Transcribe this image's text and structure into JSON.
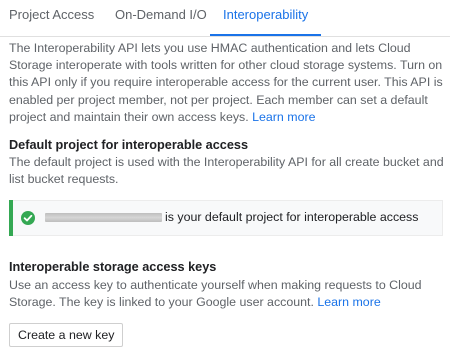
{
  "tabs": [
    {
      "label": "Project Access",
      "active": false
    },
    {
      "label": "On-Demand I/O",
      "active": false
    },
    {
      "label": "Interoperability",
      "active": true
    }
  ],
  "intro": {
    "text": "The Interoperability API lets you use HMAC authentication and lets Cloud Storage interoperate with tools written for other cloud storage systems. Turn on this API only if you require interoperable access for the current user. This API is enabled per project member, not per project. Each member can set a default project and maintain their own access keys. ",
    "link": "Learn more"
  },
  "default_project": {
    "heading": "Default project for interoperable access",
    "description": "The default project is used with the Interoperability API for all create bucket and list bucket requests.",
    "notice_text": "is your default project for interoperable access",
    "status_icon": "check-circle-icon",
    "status_color": "#34a853"
  },
  "access_keys": {
    "heading": "Interoperable storage access keys",
    "description": "Use an access key to authenticate yourself when making requests to Cloud Storage. The key is linked to your Google user account. ",
    "link": "Learn more",
    "button_label": "Create a new key"
  },
  "colors": {
    "accent": "#1a73e8",
    "success": "#34a853",
    "muted_text": "#5f6368"
  }
}
